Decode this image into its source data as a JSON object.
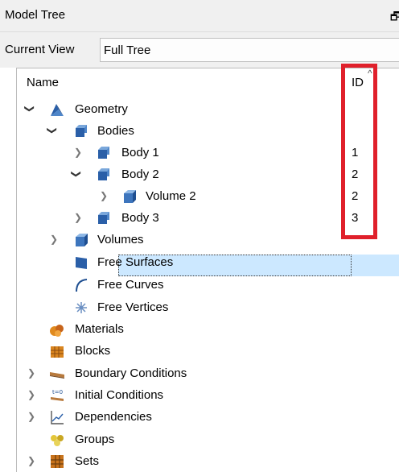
{
  "panel": {
    "title": "Model Tree",
    "float_glyph": "🗗"
  },
  "view": {
    "label": "Current View",
    "value": "Full Tree"
  },
  "columns": {
    "name": "Name",
    "id": "ID",
    "sort_glyph": "^"
  },
  "tree": [
    {
      "label": "Geometry",
      "icon": "geometry-icon",
      "id": "",
      "expanded": true
    },
    {
      "label": "Bodies",
      "icon": "bodies-icon",
      "id": "",
      "expanded": true
    },
    {
      "label": "Body 1",
      "icon": "body-icon",
      "id": "1",
      "expanded": false
    },
    {
      "label": "Body 2",
      "icon": "body-icon",
      "id": "2",
      "expanded": true
    },
    {
      "label": "Volume 2",
      "icon": "volume-icon",
      "id": "2",
      "expanded": false,
      "selected": true
    },
    {
      "label": "Body 3",
      "icon": "body-icon",
      "id": "3",
      "expanded": false
    },
    {
      "label": "Volumes",
      "icon": "volumes-icon",
      "id": "",
      "expanded": false
    },
    {
      "label": "Free Surfaces",
      "icon": "surface-icon",
      "id": ""
    },
    {
      "label": "Free Curves",
      "icon": "curve-icon",
      "id": ""
    },
    {
      "label": "Free Vertices",
      "icon": "vertex-icon",
      "id": ""
    },
    {
      "label": "Materials",
      "icon": "materials-icon",
      "id": ""
    },
    {
      "label": "Blocks",
      "icon": "blocks-icon",
      "id": ""
    },
    {
      "label": "Boundary Conditions",
      "icon": "boundary-icon",
      "id": ""
    },
    {
      "label": "Initial Conditions",
      "icon": "initial-conditions-icon",
      "id": ""
    },
    {
      "label": "Dependencies",
      "icon": "dependencies-icon",
      "id": ""
    },
    {
      "label": "Groups",
      "icon": "groups-icon",
      "id": ""
    },
    {
      "label": "Sets",
      "icon": "sets-icon",
      "id": ""
    }
  ],
  "colors": {
    "selection": "#cce8ff",
    "highlight_box": "#e0202b",
    "cube_blue": "#2a5fa8"
  }
}
